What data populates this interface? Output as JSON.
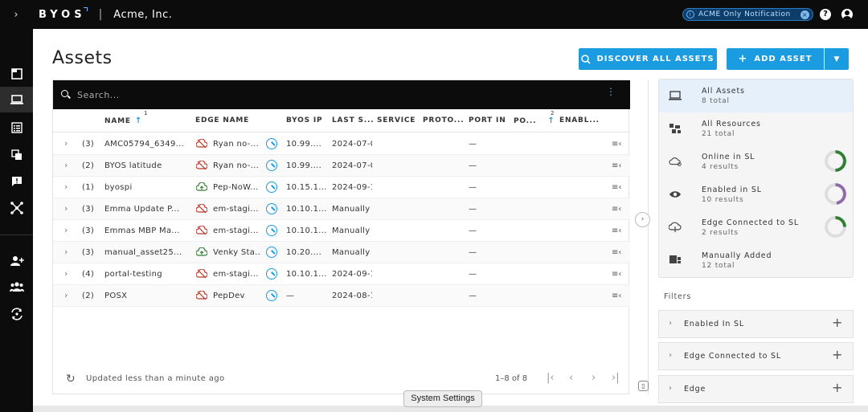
{
  "topbar": {
    "logo": "BYOS",
    "org": "Acme, Inc.",
    "notification": "ACME Only Notification",
    "icons": [
      "chevron-right-icon",
      "help-icon",
      "user-icon"
    ]
  },
  "sidenav": {
    "icons": [
      "dashboard-icon",
      "laptop-icon",
      "list-icon",
      "copy-icon",
      "feedback-icon",
      "network-icon",
      "add-user-icon",
      "group-icon",
      "sync-icon"
    ],
    "active_index": 1
  },
  "page": {
    "title": "Assets",
    "discover_label": "DISCOVER ALL ASSETS",
    "add_label": "ADD ASSET"
  },
  "search": {
    "placeholder": "Search..."
  },
  "table": {
    "columns": [
      "NAME",
      "EDGE NAME",
      "BYOS IP",
      "LAST S...",
      "SERVICE",
      "PROTO...",
      "PORT IN",
      "PO...",
      "ENABL..."
    ],
    "sort_markers": [
      "1",
      "2"
    ],
    "rows": [
      {
        "count": "(3)",
        "name": "AMC05794_6349...",
        "edge": "Ryan no-...",
        "edge_status": "offline",
        "ip": "10.99....",
        "last": "2024-07-0",
        "port_in": "—"
      },
      {
        "count": "(2)",
        "name": "BYOS latitude",
        "edge": "Ryan no-...",
        "edge_status": "offline",
        "ip": "10.99....",
        "last": "2024-07-0",
        "port_in": "—"
      },
      {
        "count": "(1)",
        "name": "byospi",
        "edge": "Pep-NoW...",
        "edge_status": "online",
        "ip": "10.15.1...",
        "last": "2024-09-1",
        "port_in": "—"
      },
      {
        "count": "(3)",
        "name": "Emma Update P...",
        "edge": "em-stagi...",
        "edge_status": "offline",
        "ip": "10.10.1...",
        "last": "Manually",
        "port_in": "—"
      },
      {
        "count": "(3)",
        "name": "Emmas MBP Ma...",
        "edge": "em-stagi...",
        "edge_status": "offline",
        "ip": "10.10.1...",
        "last": "Manually",
        "port_in": "—"
      },
      {
        "count": "(3)",
        "name": "manual_asset25...",
        "edge": "Venky Sta...",
        "edge_status": "online",
        "ip": "10.20....",
        "last": "Manually",
        "port_in": "—"
      },
      {
        "count": "(4)",
        "name": "portal-testing",
        "edge": "em-stagi...",
        "edge_status": "offline",
        "ip": "10.10.1...",
        "last": "2024-09-1",
        "port_in": "—"
      },
      {
        "count": "(2)",
        "name": "POSX",
        "edge": "PepDev",
        "edge_status": "offline",
        "ip": "—",
        "last": "2024-08-1",
        "port_in": "—"
      }
    ],
    "footer": {
      "updated": "Updated less than a minute ago",
      "page_info": "1–8 of 8"
    }
  },
  "summary": [
    {
      "label": "All Assets",
      "sub": "8 total",
      "icon": "laptop-icon",
      "active": true
    },
    {
      "label": "All Resources",
      "sub": "21 total",
      "icon": "resources-icon"
    },
    {
      "label": "Online in SL",
      "sub": "4 results",
      "icon": "cloud-icon",
      "ring_fraction": 0.5,
      "ring_color": "#2e7d32"
    },
    {
      "label": "Enabled in SL",
      "sub": "10 results",
      "icon": "eye-icon",
      "ring_fraction": 0.48,
      "ring_color": "#8e6aa8"
    },
    {
      "label": "Edge Connected to SL",
      "sub": "2 results",
      "icon": "cloud-link-icon",
      "ring_fraction": 0.25,
      "ring_color": "#2e7d32"
    },
    {
      "label": "Manually Added",
      "sub": "12 total",
      "icon": "manual-icon"
    }
  ],
  "filters": {
    "label": "Filters",
    "items": [
      "Enabled In SL",
      "Edge Connected to SL",
      "Edge"
    ]
  },
  "tooltip": "System Settings",
  "colors": {
    "accent": "#1b9be0",
    "offline": "#c0392b",
    "online": "#2e7d32"
  }
}
